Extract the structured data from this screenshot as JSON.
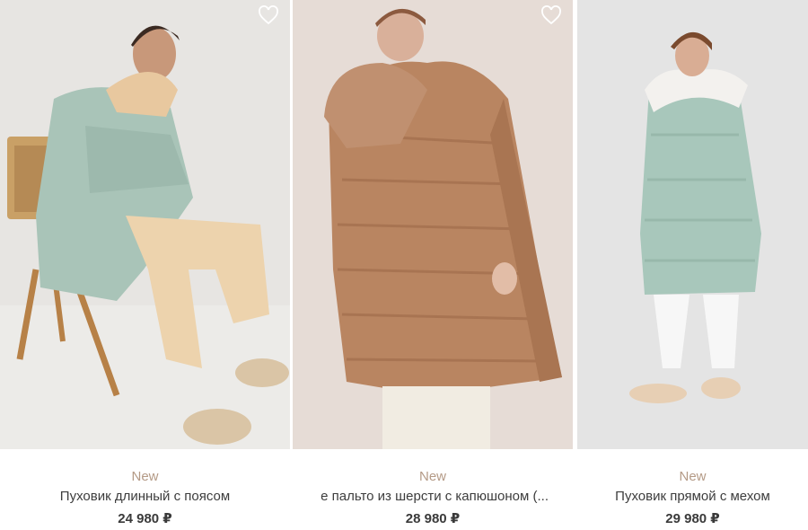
{
  "products": [
    {
      "badge": "New",
      "title": "Пуховик длинный с поясом",
      "price": "24 980 ₽",
      "favorite_icon": "heart-outline-icon",
      "photo_bg": "#e7e5e2",
      "garment_color": "#a9c4b8"
    },
    {
      "badge": "New",
      "title": "е пальто из шерсти с капюшоном (...",
      "price": "28 980 ₽",
      "favorite_icon": "heart-outline-icon",
      "photo_bg": "#e6dcd6",
      "garment_color": "#b98561"
    },
    {
      "badge": "New",
      "title": "Пуховик прямой с мехом",
      "price": "29 980 ₽",
      "favorite_icon": "heart-outline-icon",
      "photo_bg": "#e4e4e4",
      "garment_color": "#a8c7bb"
    }
  ],
  "colors": {
    "badge": "#b49a86",
    "text": "#3d3d3d"
  }
}
